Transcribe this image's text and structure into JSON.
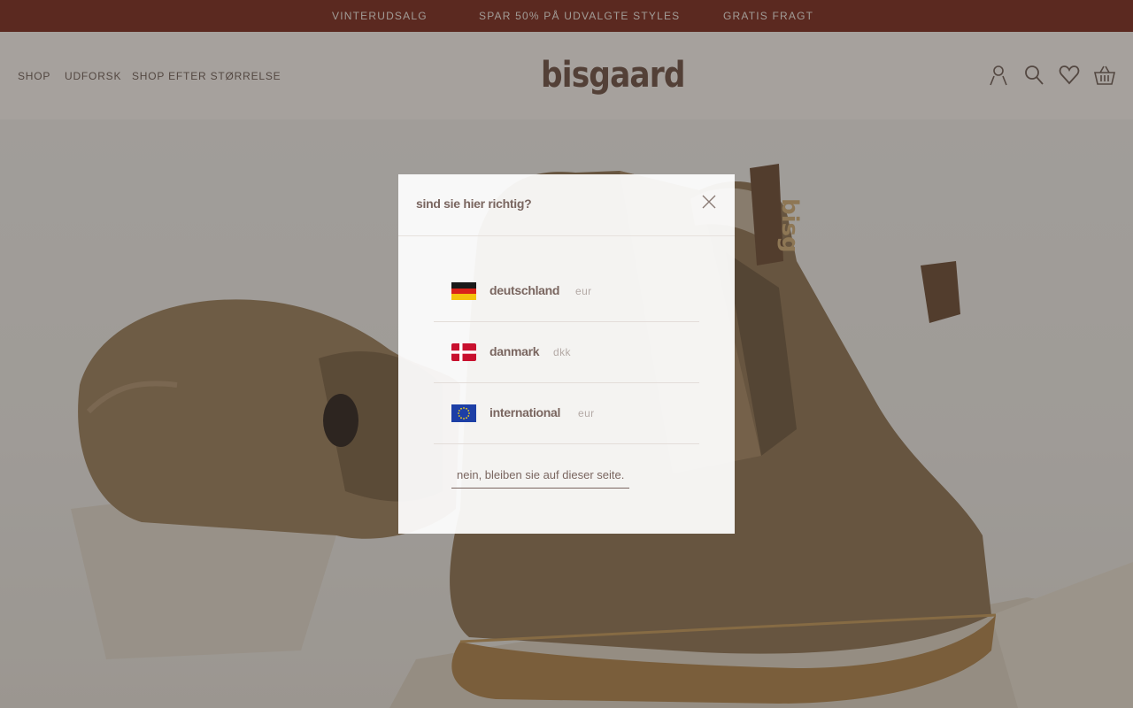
{
  "announcement": {
    "items": [
      "VINTERUDSALG",
      "SPAR 50% PÅ UDVALGTE STYLES",
      "GRATIS FRAGT"
    ]
  },
  "header": {
    "nav": [
      "SHOP",
      "UDFORSK",
      "SHOP EFTER STØRRELSE"
    ],
    "logo": "bisgaard",
    "icons": [
      "account-icon",
      "search-icon",
      "wishlist-heart-icon",
      "basket-icon"
    ]
  },
  "hero": {
    "product": "brown leather chelsea boot with wool lining"
  },
  "modal": {
    "title": "sind sie hier richtig?",
    "options": [
      {
        "country": "deutschland",
        "currency": "eur",
        "flag": "germany-flag-icon"
      },
      {
        "country": "danmark",
        "currency": "dkk",
        "flag": "denmark-flag-icon"
      },
      {
        "country": "international",
        "currency": "eur",
        "flag": "eu-flag-icon"
      }
    ],
    "stay_label": "nein, bleiben sie auf dieser seite."
  },
  "colors": {
    "announcement_bg": "#7a2a20",
    "brand_text": "#6d5148",
    "overlay": "rgba(48,40,34,0.42)"
  }
}
